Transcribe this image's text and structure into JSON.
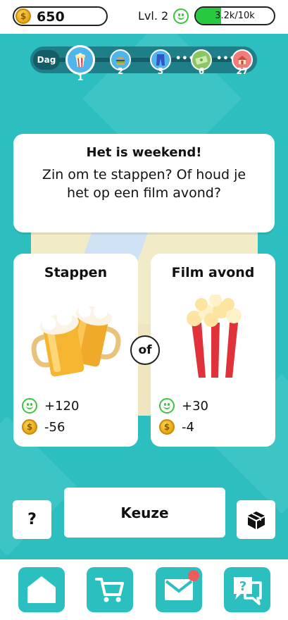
{
  "hud": {
    "coins": "650",
    "coin_symbol": "$",
    "level_label": "Lvl. 2",
    "xp_text": "3.2k/10k",
    "xp_progress": 0.32
  },
  "day_track": {
    "label": "Dag",
    "nodes": [
      {
        "number": "1",
        "icon": "popcorn-icon",
        "current": true
      },
      {
        "number": "2",
        "icon": "burger-icon",
        "current": false
      },
      {
        "number": "3",
        "icon": "jeans-icon",
        "current": false
      },
      {
        "number": "6",
        "icon": "money-icon",
        "current": false
      },
      {
        "number": "27",
        "icon": "house-icon",
        "current": false
      }
    ],
    "ellipsis": "•••"
  },
  "question": {
    "title": "Het is weekend!",
    "text": "Zin om te stappen? Of houd je het op een film avond?"
  },
  "choices": {
    "left": {
      "title": "Stappen",
      "image": "beer-mugs-icon",
      "happiness": "+120",
      "money": "-56"
    },
    "right": {
      "title": "Film avond",
      "image": "popcorn-icon",
      "happiness": "+30",
      "money": "-4"
    },
    "or_label": "of"
  },
  "actions": {
    "help_label": "?",
    "choose_label": "Keuze",
    "box_icon": "box-icon"
  },
  "nav": {
    "items": [
      {
        "icon": "home-icon"
      },
      {
        "icon": "cart-icon"
      },
      {
        "icon": "mail-icon",
        "notification": true
      },
      {
        "icon": "help-chat-icon"
      }
    ]
  },
  "colors": {
    "background": "#2dbfc0",
    "accent": "#2cbfbf",
    "xp_fill": "#27c93f",
    "happiness": "#3fc33f",
    "coin": "#e7a613",
    "notification": "#ef5b5b"
  }
}
